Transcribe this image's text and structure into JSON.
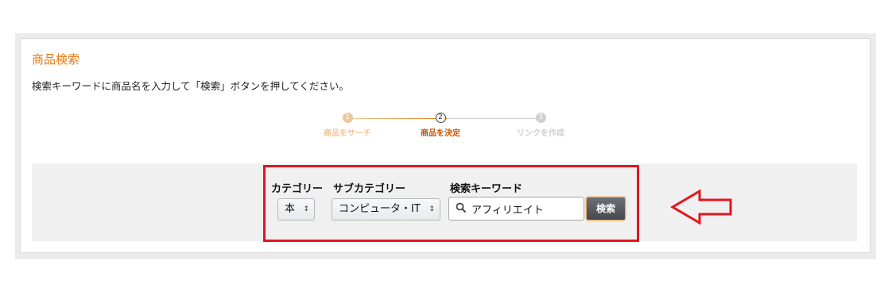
{
  "title": "商品検索",
  "description": "検索キーワードに商品名を入力して「検索」ボタンを押してください。",
  "steps": [
    {
      "number": "1",
      "label": "商品をサーチ"
    },
    {
      "number": "2",
      "label": "商品を決定"
    },
    {
      "number": "3",
      "label": "リンクを作成"
    }
  ],
  "form": {
    "category_label": "カテゴリー",
    "category_value": "本",
    "subcategory_label": "サブカテゴリー",
    "subcategory_value": "コンピュータ・IT",
    "keyword_label": "検索キーワード",
    "keyword_value": "アフィリエイト",
    "search_button": "検索"
  },
  "icons": {
    "select_arrow": "up-down-arrow-icon",
    "search": "search-icon",
    "annotation": "left-arrow-icon"
  },
  "colors": {
    "title": "#e47911",
    "annotation_red": "#e3151f"
  }
}
